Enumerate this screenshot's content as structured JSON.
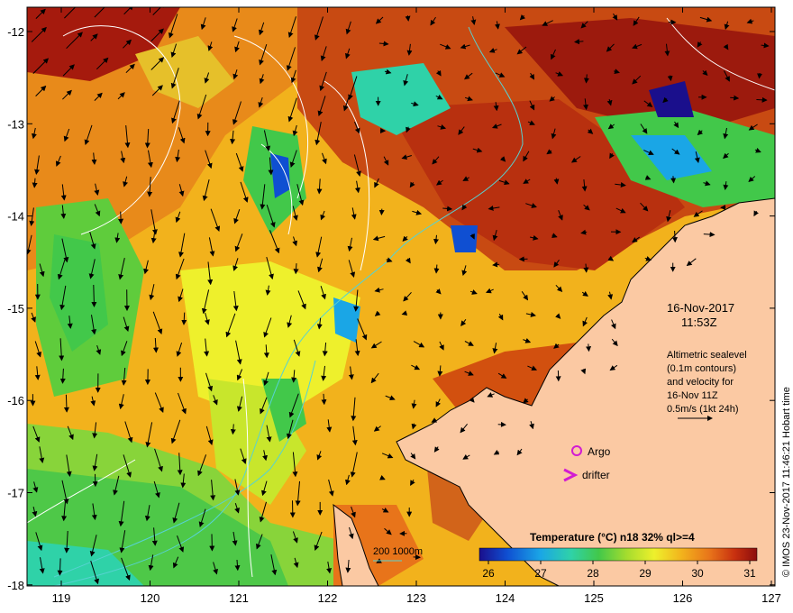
{
  "map": {
    "longitude_ticks": [
      "119",
      "120",
      "121",
      "122",
      "123",
      "124",
      "125",
      "126",
      "127"
    ],
    "latitude_ticks": [
      "-12",
      "-13",
      "-14",
      "-15",
      "-16",
      "-17",
      "-18"
    ],
    "colors": {
      "land": "#fbc9a3",
      "coast": "#000000",
      "contour": "#ffffff",
      "bathymetry": "#57d2d2",
      "argo": "#d21bd2",
      "drifter": "#d21bd2"
    }
  },
  "annotations": {
    "date": "16-Nov-2017",
    "time": "11:53Z",
    "sealevel_lines": [
      "Altimetric sealevel",
      "(0.1m contours)",
      "and velocity for",
      "16-Nov 11Z",
      "0.5m/s (1kt 24h)"
    ],
    "argo_label": "Argo",
    "drifter_label": "drifter",
    "depth_legend": "200  1000m",
    "credit": "© IMOS 23-Nov-2017 11:46:21 Hobart time"
  },
  "colorbar": {
    "title": "Temperature (°C) n18 32% ql>=4",
    "ticks": [
      "26",
      "27",
      "28",
      "29",
      "30",
      "31"
    ],
    "colors": [
      "#1a0f8c",
      "#0f4fd2",
      "#1aa6e6",
      "#2fd2a8",
      "#42c84a",
      "#a4dc2e",
      "#eef02c",
      "#f2b21c",
      "#e8741a",
      "#c8300f",
      "#8c0d0d"
    ]
  }
}
